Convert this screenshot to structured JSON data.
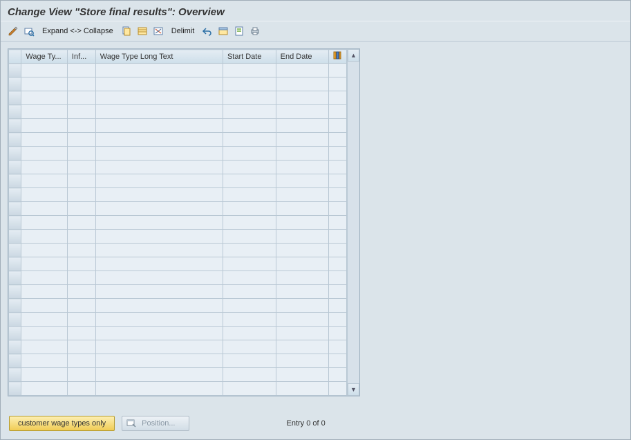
{
  "title": "Change View \"Store final results\": Overview",
  "toolbar": {
    "expand_collapse": "Expand <-> Collapse",
    "delimit": "Delimit"
  },
  "columns": {
    "wage_type": "Wage Ty...",
    "inf": "Inf...",
    "long_text": "Wage Type Long Text",
    "start": "Start Date",
    "end": "End Date"
  },
  "rows": [
    {},
    {},
    {},
    {},
    {},
    {},
    {},
    {},
    {},
    {},
    {},
    {},
    {},
    {},
    {},
    {},
    {},
    {},
    {},
    {},
    {},
    {},
    {},
    {}
  ],
  "footer": {
    "customer_button": "customer wage types only",
    "position_button": "Position...",
    "status": "Entry 0 of 0"
  }
}
